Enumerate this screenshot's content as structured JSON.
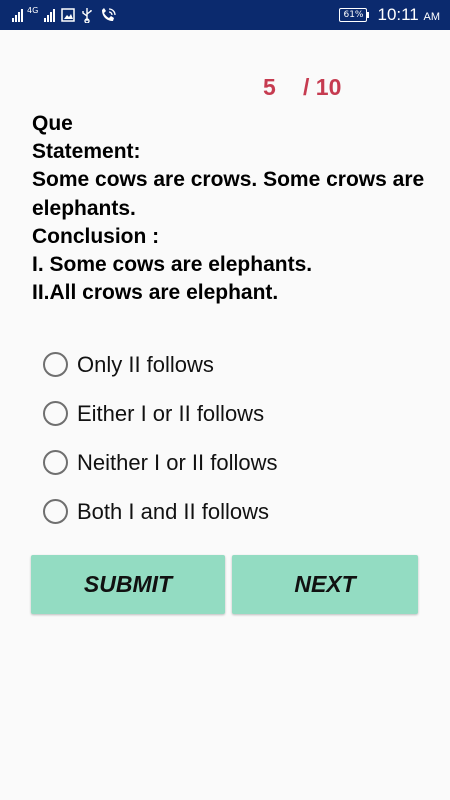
{
  "status_bar": {
    "network_type": "4G",
    "battery": "61%",
    "time": "10:11",
    "ampm": "AM",
    "icons": [
      "signal-icon",
      "signal-icon",
      "image-icon",
      "usb-icon",
      "phone-wifi-icon",
      "battery-icon"
    ]
  },
  "progress": {
    "current": "5",
    "total": "/ 10"
  },
  "question": {
    "label": "Que",
    "lines": [
      "Statement:",
      "Some cows are crows. Some crows are elephants.",
      "Conclusion :",
      "I. Some cows are elephants.",
      "II.All crows are elephant."
    ]
  },
  "options": [
    {
      "label": "Only II follows"
    },
    {
      "label": "Either I or II follows"
    },
    {
      "label": "Neither I or II follows"
    },
    {
      "label": "Both I and II follows"
    }
  ],
  "buttons": {
    "submit": "SUBMIT",
    "next": "NEXT"
  },
  "colors": {
    "status_bar": "#0b2a6e",
    "counter": "#c63b50",
    "button": "#93dcc2",
    "background": "#fafafa"
  }
}
